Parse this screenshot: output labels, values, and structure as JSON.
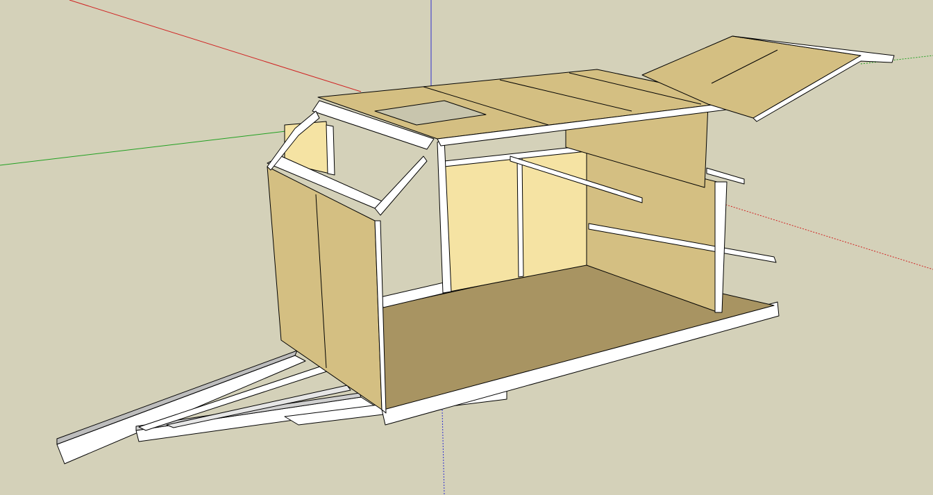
{
  "app": {
    "type": "3d-modeling-viewport",
    "background_color": "#d4d1b9"
  },
  "axes": {
    "red_axis_color": "#d02020",
    "green_axis_color": "#20a020",
    "blue_axis_color": "#3030d0"
  },
  "model": {
    "subject": "camper-trailer-frame",
    "panel_color": "#d4bf82",
    "panel_light_color": "#f5e3a3",
    "floor_color": "#a89462",
    "frame_color": "#ffffff",
    "frame_shadow_color": "#bdbdbd",
    "edge_color": "#000000"
  }
}
